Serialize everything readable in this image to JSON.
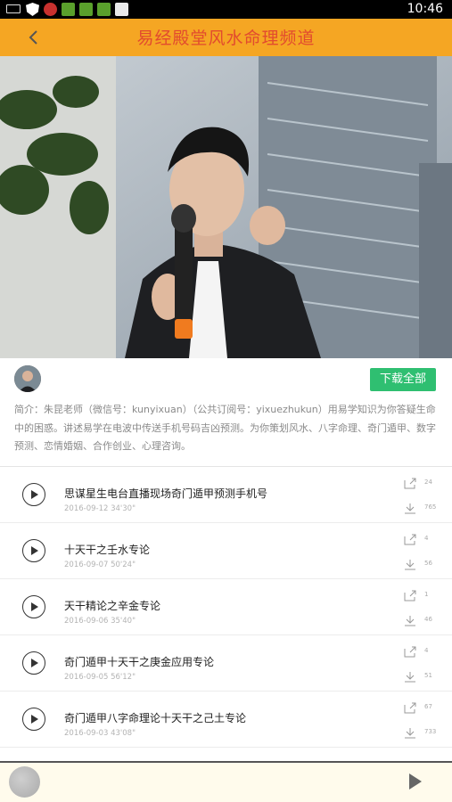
{
  "status_bar": {
    "time": "10:46",
    "icons": [
      "battery-icon",
      "shield-icon",
      "app-red-icon",
      "app-green-icon",
      "app-green-icon",
      "app-green-icon",
      "app-photo-icon"
    ]
  },
  "header": {
    "title": "易经殿堂风水命理频道",
    "back_icon": "chevron-left-icon"
  },
  "channel": {
    "download_all_label": "下载全部",
    "description": "简介：朱昆老师（微信号：kunyixuan）（公共订阅号：yixuezhukun）用易学知识为你答疑生命中的困惑。讲述易学在电波中传送手机号码吉凶预测。为你策划风水、八字命理、奇门遁甲、数字预测、恋情婚姻、合作创业、心理咨询。"
  },
  "tracks": [
    {
      "title": "思谋星生电台直播现场奇门遁甲预测手机号",
      "date": "2016-09-12",
      "duration": "34'30\"",
      "share_count": "24",
      "download_count": "765"
    },
    {
      "title": "十天干之壬水专论",
      "date": "2016-09-07",
      "duration": "50'24\"",
      "share_count": "4",
      "download_count": "56"
    },
    {
      "title": "天干精论之辛金专论",
      "date": "2016-09-06",
      "duration": "35'40\"",
      "share_count": "1",
      "download_count": "46"
    },
    {
      "title": "奇门遁甲十天干之庚金应用专论",
      "date": "2016-09-05",
      "duration": "56'12\"",
      "share_count": "4",
      "download_count": "51"
    },
    {
      "title": "奇门遁甲八字命理论十天干之己土专论",
      "date": "2016-09-03",
      "duration": "43'08\"",
      "share_count": "67",
      "download_count": "733"
    }
  ],
  "colors": {
    "header": "#f5a623",
    "title": "#e24b2e",
    "download_button": "#2fbf71",
    "player_bg": "#fffbec"
  }
}
